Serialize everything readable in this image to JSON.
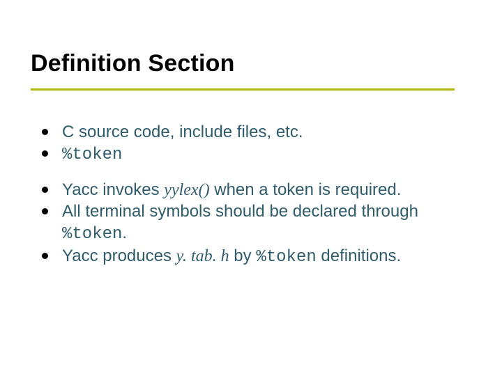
{
  "title": "Definition Section",
  "bullets": {
    "b1_a": "C source code, include files, etc.",
    "b2_a": "%token",
    "b3_a": "Yacc invokes ",
    "b3_b": "yylex()",
    "b3_c": " when a token is required.",
    "b4_a": "All terminal symbols should be declared through ",
    "b4_b": "%token",
    "b4_c": ".",
    "b5_a": "Yacc produces ",
    "b5_b": "y. tab. h",
    "b5_c": " by ",
    "b5_d": "%token",
    "b5_e": " definitions."
  }
}
